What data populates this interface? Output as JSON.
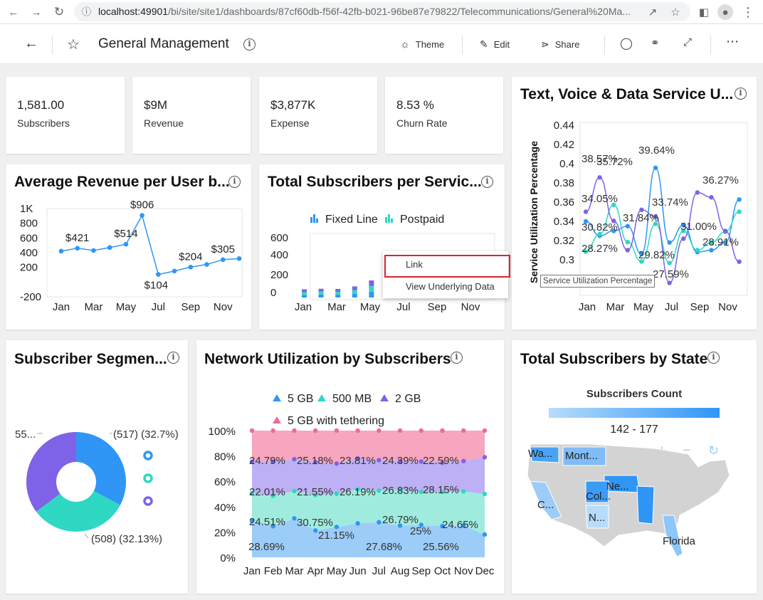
{
  "browser": {
    "url_host": "localhost:49901",
    "url_path": "/bi/site/site1/dashboards/87cf60db-f56f-42fb-b021-96be87e79822/Telecommunications/General%20Ma..."
  },
  "appbar": {
    "title": "General Management",
    "theme_label": "Theme",
    "edit_label": "Edit",
    "share_label": "Share"
  },
  "kpis": [
    {
      "value": "1,581.00",
      "label": "Subscribers"
    },
    {
      "value": "$9M",
      "label": "Revenue"
    },
    {
      "value": "$3,877K",
      "label": "Expense"
    },
    {
      "value": "8.53 %",
      "label": "Churn Rate"
    }
  ],
  "colors": {
    "blue": "#2f96f5",
    "teal": "#2ed8c3",
    "purple": "#7e62e8",
    "pink": "#f06a94",
    "menu_highlight": "#d9232d"
  },
  "context_menu": {
    "items": [
      "Link",
      "View Underlying Data"
    ]
  },
  "tooltip": "Service Utilization Percentage",
  "chart_data": [
    {
      "id": "arpu",
      "type": "line",
      "title": "Average Revenue per User b...",
      "x_ticks": [
        "Jan",
        "Mar",
        "May",
        "Jul",
        "Sep",
        "Nov"
      ],
      "y_ticks": [
        "1K",
        "800",
        "600",
        "400",
        "200",
        "-200"
      ],
      "ylim": [
        -200,
        1000
      ],
      "categories": [
        "Jan",
        "Feb",
        "Mar",
        "Apr",
        "May",
        "Jun",
        "Jul",
        "Aug",
        "Sep",
        "Oct",
        "Nov",
        "Dec"
      ],
      "values": [
        421,
        460,
        430,
        470,
        514,
        906,
        104,
        150,
        204,
        240,
        305,
        320
      ],
      "data_labels": [
        {
          "i": 1,
          "text": "$421"
        },
        {
          "i": 4,
          "text": "$514"
        },
        {
          "i": 5,
          "text": "$906"
        },
        {
          "i": 6,
          "text": "$104"
        },
        {
          "i": 8,
          "text": "$204"
        },
        {
          "i": 10,
          "text": "$305"
        }
      ]
    },
    {
      "id": "subs_service",
      "type": "bar",
      "title": "Total Subscribers per Servic...",
      "legend": [
        "Fixed Line",
        "Postpaid"
      ],
      "x_ticks": [
        "Jan",
        "Mar",
        "May",
        "Jul",
        "Sep",
        "Nov"
      ],
      "y_ticks": [
        "600",
        "400",
        "200",
        "0"
      ],
      "ylim": [
        0,
        600
      ],
      "categories": [
        "Jan",
        "Feb",
        "Mar",
        "Apr",
        "May",
        "Jun"
      ],
      "series": [
        {
          "name": "Fixed Line",
          "values": [
            28,
            32,
            30,
            40,
            62,
            135
          ]
        },
        {
          "name": "Postpaid",
          "values": [
            30,
            32,
            32,
            40,
            62,
            135
          ]
        },
        {
          "name": "",
          "values": [
            30,
            30,
            30,
            40,
            60,
            140
          ]
        }
      ]
    },
    {
      "id": "service_util",
      "type": "line",
      "title": "Text, Voice & Data Service U...",
      "ylabel": "Service Utilization Percentage",
      "x_ticks": [
        "Jan",
        "Mar",
        "May",
        "Jul",
        "Sep",
        "Nov"
      ],
      "y_ticks": [
        "0.44",
        "0.42",
        "0.4",
        "0.38",
        "0.36",
        "0.34",
        "0.32",
        "0.3",
        "0.28"
      ],
      "ylim": [
        0.27,
        0.445
      ],
      "categories": [
        "Jan",
        "Feb",
        "Mar",
        "Apr",
        "May",
        "Jun",
        "Jul",
        "Aug",
        "Sep",
        "Oct",
        "Nov",
        "Dec"
      ],
      "series": [
        {
          "values": [
            0.34,
            0.325,
            0.33,
            0.335,
            0.306,
            0.3957,
            0.318,
            0.336,
            0.308,
            0.31,
            0.318,
            0.3627
          ]
        },
        {
          "values": [
            0.3085,
            0.3268,
            0.3572,
            0.3184,
            0.2982,
            0.3374,
            0.2966,
            0.33,
            0.31,
            0.318,
            0.3291,
            0.35
          ]
        },
        {
          "values": [
            0.35,
            0.3857,
            0.3405,
            0.31,
            0.352,
            0.345,
            0.2759,
            0.322,
            0.37,
            0.365,
            0.33,
            0.298
          ]
        }
      ],
      "data_labels": [
        "38.57%",
        "35.72%",
        "34.05%",
        "39.64%",
        "31.84%",
        "33.74%",
        "30.82%",
        "29.82%",
        "31.00%",
        "36.27%",
        "28.27%",
        "27.59%",
        "28.91%"
      ]
    },
    {
      "id": "segment",
      "type": "pie",
      "title": "Subscriber Segmen...",
      "slices": [
        {
          "value": 517,
          "label": "(517) (32.7%)"
        },
        {
          "value": 508,
          "label": "(508) (32.13%)"
        },
        {
          "value": 556,
          "label": "55..."
        }
      ]
    },
    {
      "id": "network",
      "type": "area",
      "title": "Network Utilization by Subscribers",
      "legend": [
        "5 GB",
        "500 MB",
        "2 GB",
        "5 GB with tethering"
      ],
      "x_ticks": [
        "Jan",
        "Feb",
        "Mar",
        "Apr",
        "May",
        "Jun",
        "Jul",
        "Aug",
        "Sep",
        "Oct",
        "Nov",
        "Dec"
      ],
      "y_ticks": [
        "100%",
        "80%",
        "60%",
        "40%",
        "20%",
        "0%"
      ],
      "series": [
        {
          "name": "5 GB",
          "values": [
            28.69,
            24.51,
            30.75,
            21.15,
            24,
            26.79,
            27.68,
            25,
            25.56,
            24.65,
            25,
            18
          ]
        },
        {
          "name": "500 MB",
          "values": [
            22.01,
            24,
            21.55,
            28,
            26.19,
            26.83,
            25,
            28.15,
            26,
            27,
            27,
            32
          ]
        },
        {
          "name": "2 GB",
          "values": [
            24.79,
            27,
            25.18,
            26,
            23.81,
            24.39,
            24,
            22.59,
            24,
            23,
            24,
            29
          ]
        },
        {
          "name": "5 GB with tethering",
          "values": [
            24.51,
            24.49,
            22.52,
            24.85,
            26,
            21.99,
            23.32,
            24.26,
            24.44,
            25.35,
            24,
            21
          ]
        }
      ],
      "data_labels": [
        "24.79%",
        "25.18%",
        "23.81%",
        "24.39%",
        "22.59%",
        "22.01%",
        "21.55%",
        "26.19%",
        "26.83%",
        "28.15%",
        "24.51%",
        "30.75%",
        "26.79%",
        "24.65%",
        "21.15%",
        "25%",
        "28.69%",
        "27.68%",
        "25.56%"
      ]
    },
    {
      "id": "state",
      "type": "map",
      "title": "Total Subscribers by State",
      "legend_title": "Subscribers Count",
      "legend_range": "142 - 177",
      "labels": [
        "Wa...",
        "Mont...",
        "Ne...",
        "Col...",
        "C...",
        "N...",
        "Florida"
      ]
    }
  ]
}
